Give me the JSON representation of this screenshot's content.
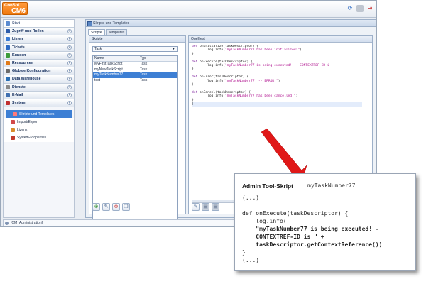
{
  "app": {
    "logo_top": "ConSol",
    "logo_main": "CM6",
    "status_user": "[CM_Administration]"
  },
  "sidebar": {
    "start": "Start",
    "items": [
      {
        "label": "Zugriff und Rollen",
        "color": "#2c5cab"
      },
      {
        "label": "Listen",
        "color": "#3a7bd5"
      },
      {
        "label": "Tickets",
        "color": "#2d6bc4"
      },
      {
        "label": "Kunden",
        "color": "#3b9b3b"
      },
      {
        "label": "Ressourcen",
        "color": "#e07b1a"
      },
      {
        "label": "Globale Konfiguration",
        "color": "#6b6b6b"
      },
      {
        "label": "Data Warehouse",
        "color": "#2a6fb5"
      },
      {
        "label": "Dienste",
        "color": "#8a8a8a"
      },
      {
        "label": "E-Mail",
        "color": "#3f6fb0"
      },
      {
        "label": "System",
        "color": "#c03030"
      }
    ],
    "system_children": [
      {
        "label": "Skripte und Templates",
        "selected": true
      },
      {
        "label": "Import/Export",
        "selected": false
      },
      {
        "label": "Lizenz",
        "selected": false
      },
      {
        "label": "System-Properties",
        "selected": false
      }
    ]
  },
  "main": {
    "title": "Skripte und Templates",
    "tabs": [
      "Skripte",
      "Templates"
    ],
    "scripts_panel_title": "Skripte",
    "script_type_selected": "Task",
    "table_headers": [
      "Name",
      "Typ"
    ],
    "rows": [
      {
        "name": "MyFirstTaskScript",
        "type": "Task"
      },
      {
        "name": "myNewTaskScript",
        "type": "Task"
      },
      {
        "name": "myTaskNumber77",
        "type": "Task"
      },
      {
        "name": "test",
        "type": "Task"
      }
    ],
    "source_panel_title": "Quelltext"
  },
  "callout": {
    "title": "Admin Tool-Skript",
    "script_name": "myTaskNumber77",
    "ellipsis": "(...)",
    "line1": "def onExecute(taskDescriptor) {",
    "line2": "    log.info(",
    "line3": "    \"myTaskNumber77 is being executed! -",
    "line4": "    CONTEXTREF-ID is \" +",
    "line5": "    taskDescriptor.getContextReference())",
    "line6": "}",
    "ellipsis_end": "(...)"
  }
}
